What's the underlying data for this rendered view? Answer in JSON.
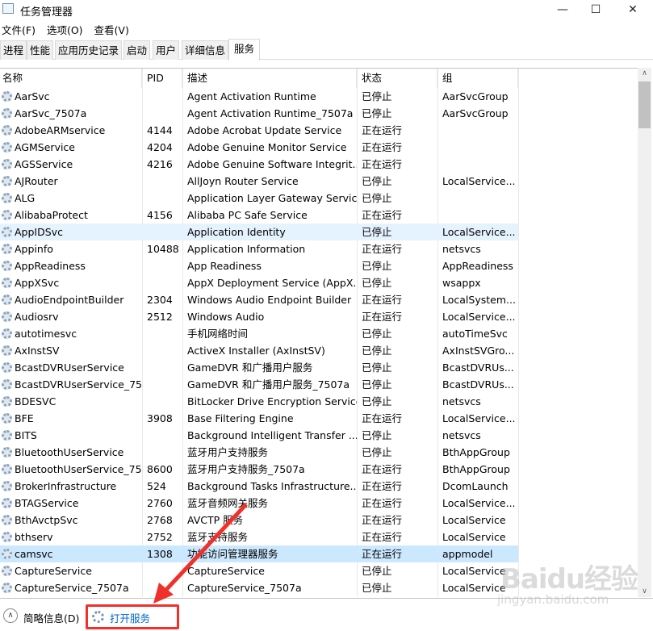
{
  "window": {
    "title": "任务管理器",
    "minimize": "—",
    "maximize": "☐",
    "close": "✕"
  },
  "menu": [
    "文件(F)",
    "选项(O)",
    "查看(V)"
  ],
  "tabs": [
    "进程",
    "性能",
    "应用历史记录",
    "启动",
    "用户",
    "详细信息",
    "服务"
  ],
  "active_tab": "服务",
  "columns": {
    "name": "名称",
    "pid": "PID",
    "desc": "描述",
    "status": "状态",
    "group": "组"
  },
  "rows": [
    [
      "AarSvc",
      "",
      "Agent Activation Runtime",
      "已停止",
      "AarSvcGroup"
    ],
    [
      "AarSvc_7507a",
      "",
      "Agent Activation Runtime_7507a",
      "已停止",
      "AarSvcGroup"
    ],
    [
      "AdobeARMservice",
      "4144",
      "Adobe Acrobat Update Service",
      "正在运行",
      ""
    ],
    [
      "AGMService",
      "4204",
      "Adobe Genuine Monitor Service",
      "正在运行",
      ""
    ],
    [
      "AGSService",
      "4216",
      "Adobe Genuine Software Integrit...",
      "正在运行",
      ""
    ],
    [
      "AJRouter",
      "",
      "AllJoyn Router Service",
      "已停止",
      "LocalService..."
    ],
    [
      "ALG",
      "",
      "Application Layer Gateway Service",
      "已停止",
      ""
    ],
    [
      "AlibabaProtect",
      "4156",
      "Alibaba PC Safe Service",
      "正在运行",
      ""
    ],
    [
      "AppIDSvc",
      "",
      "Application Identity",
      "已停止",
      "LocalService..."
    ],
    [
      "Appinfo",
      "10488",
      "Application Information",
      "正在运行",
      "netsvcs"
    ],
    [
      "AppReadiness",
      "",
      "App Readiness",
      "已停止",
      "AppReadiness"
    ],
    [
      "AppXSvc",
      "",
      "AppX Deployment Service (AppX...",
      "已停止",
      "wsappx"
    ],
    [
      "AudioEndpointBuilder",
      "2304",
      "Windows Audio Endpoint Builder",
      "正在运行",
      "LocalSystem..."
    ],
    [
      "Audiosrv",
      "2512",
      "Windows Audio",
      "正在运行",
      "LocalService..."
    ],
    [
      "autotimesvc",
      "",
      "手机网络时间",
      "已停止",
      "autoTimeSvc"
    ],
    [
      "AxInstSV",
      "",
      "ActiveX Installer (AxInstSV)",
      "已停止",
      "AxInstSVGro..."
    ],
    [
      "BcastDVRUserService",
      "",
      "GameDVR 和广播用户服务",
      "已停止",
      "BcastDVRUs..."
    ],
    [
      "BcastDVRUserService_75...",
      "",
      "GameDVR 和广播用户服务_7507a",
      "已停止",
      "BcastDVRUs..."
    ],
    [
      "BDESVC",
      "",
      "BitLocker Drive Encryption Service",
      "已停止",
      "netsvcs"
    ],
    [
      "BFE",
      "3908",
      "Base Filtering Engine",
      "正在运行",
      "LocalService..."
    ],
    [
      "BITS",
      "",
      "Background Intelligent Transfer ...",
      "已停止",
      "netsvcs"
    ],
    [
      "BluetoothUserService",
      "",
      "蓝牙用户支持服务",
      "已停止",
      "BthAppGroup"
    ],
    [
      "BluetoothUserService_75...",
      "8600",
      "蓝牙用户支持服务_7507a",
      "正在运行",
      "BthAppGroup"
    ],
    [
      "BrokerInfrastructure",
      "524",
      "Background Tasks Infrastructure...",
      "正在运行",
      "DcomLaunch"
    ],
    [
      "BTAGService",
      "2760",
      "蓝牙音频网关服务",
      "正在运行",
      "LocalService..."
    ],
    [
      "BthAvctpSvc",
      "2768",
      "AVCTP 服务",
      "正在运行",
      "LocalService"
    ],
    [
      "bthserv",
      "2752",
      "蓝牙支持服务",
      "正在运行",
      "LocalService"
    ],
    [
      "camsvc",
      "1308",
      "功能访问管理器服务",
      "正在运行",
      "appmodel"
    ],
    [
      "CaptureService",
      "",
      "CaptureService",
      "已停止",
      "LocalService"
    ],
    [
      "CaptureService_7507a",
      "",
      "CaptureService_7507a",
      "已停止",
      "LocalService"
    ]
  ],
  "selected_row": "camsvc",
  "hover_row": "AppIDSvc",
  "footer": {
    "brief": "简略信息(D)",
    "open_services": "打开服务"
  },
  "watermark": {
    "logo": "Bai du 经验",
    "url": "jingyan.baidu.com"
  },
  "colors": {
    "selected": "#cce8ff",
    "hover": "#e5f3ff",
    "link": "#0066cc",
    "annotation": "#f0312b"
  }
}
